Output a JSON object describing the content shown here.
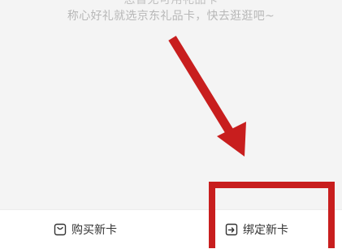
{
  "empty_state": {
    "title": "您暂无可用礼品卡",
    "subtitle": "称心好礼就选京东礼品卡，快去逛逛吧~"
  },
  "bottom_bar": {
    "buy_label": "购买新卡",
    "bind_label": "绑定新卡",
    "buy_icon": "shopping-bag-icon",
    "bind_icon": "card-bind-icon"
  },
  "colors": {
    "annotation_red": "#c81e1e",
    "bar_background": "#ffffff",
    "page_background": "#f4f4f4"
  }
}
